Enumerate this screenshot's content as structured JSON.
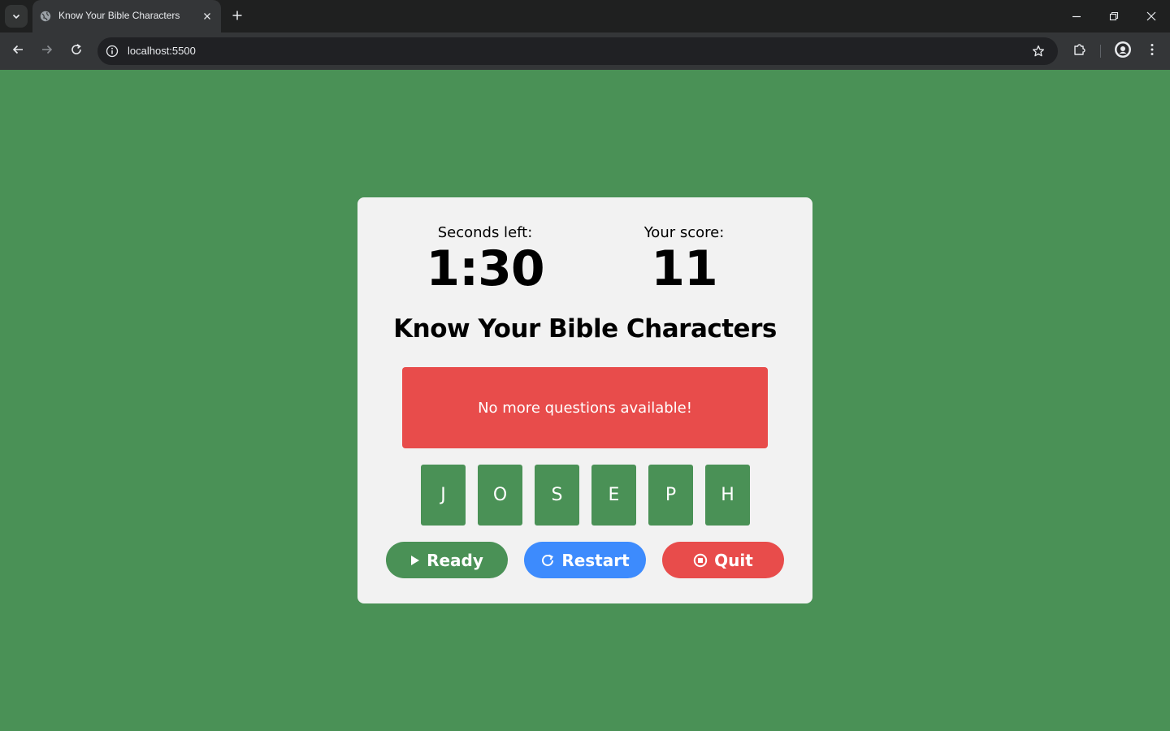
{
  "browser": {
    "tab_title": "Know Your Bible Characters",
    "url": "localhost:5500",
    "icons": {
      "tab_list": "chevron-down-icon",
      "favicon": "globe-icon",
      "tab_close": "close-icon",
      "new_tab": "plus-icon",
      "back": "arrow-left-icon",
      "forward": "arrow-right-icon",
      "reload": "reload-icon",
      "site_info": "info-icon",
      "bookmark": "star-icon",
      "extensions": "puzzle-icon",
      "profile": "profile-icon",
      "menu": "kebab-menu-icon",
      "minimize": "minimize-icon",
      "restore": "restore-icon",
      "close_window": "close-icon"
    }
  },
  "game": {
    "timer_label": "Seconds left:",
    "timer_value": "1:30",
    "score_label": "Your score:",
    "score_value": "11",
    "title": "Know Your Bible Characters",
    "message": "No more questions available!",
    "letters": [
      "J",
      "O",
      "S",
      "E",
      "P",
      "H"
    ],
    "buttons": {
      "ready": "Ready",
      "restart": "Restart",
      "quit": "Quit"
    }
  },
  "colors": {
    "page_background": "#4a9156",
    "card_background": "#f2f2f2",
    "message_background": "#e84c4b",
    "tile_background": "#4a9156",
    "ready_button": "#4a9156",
    "restart_button": "#3d8bfd",
    "quit_button": "#e84c4b"
  }
}
